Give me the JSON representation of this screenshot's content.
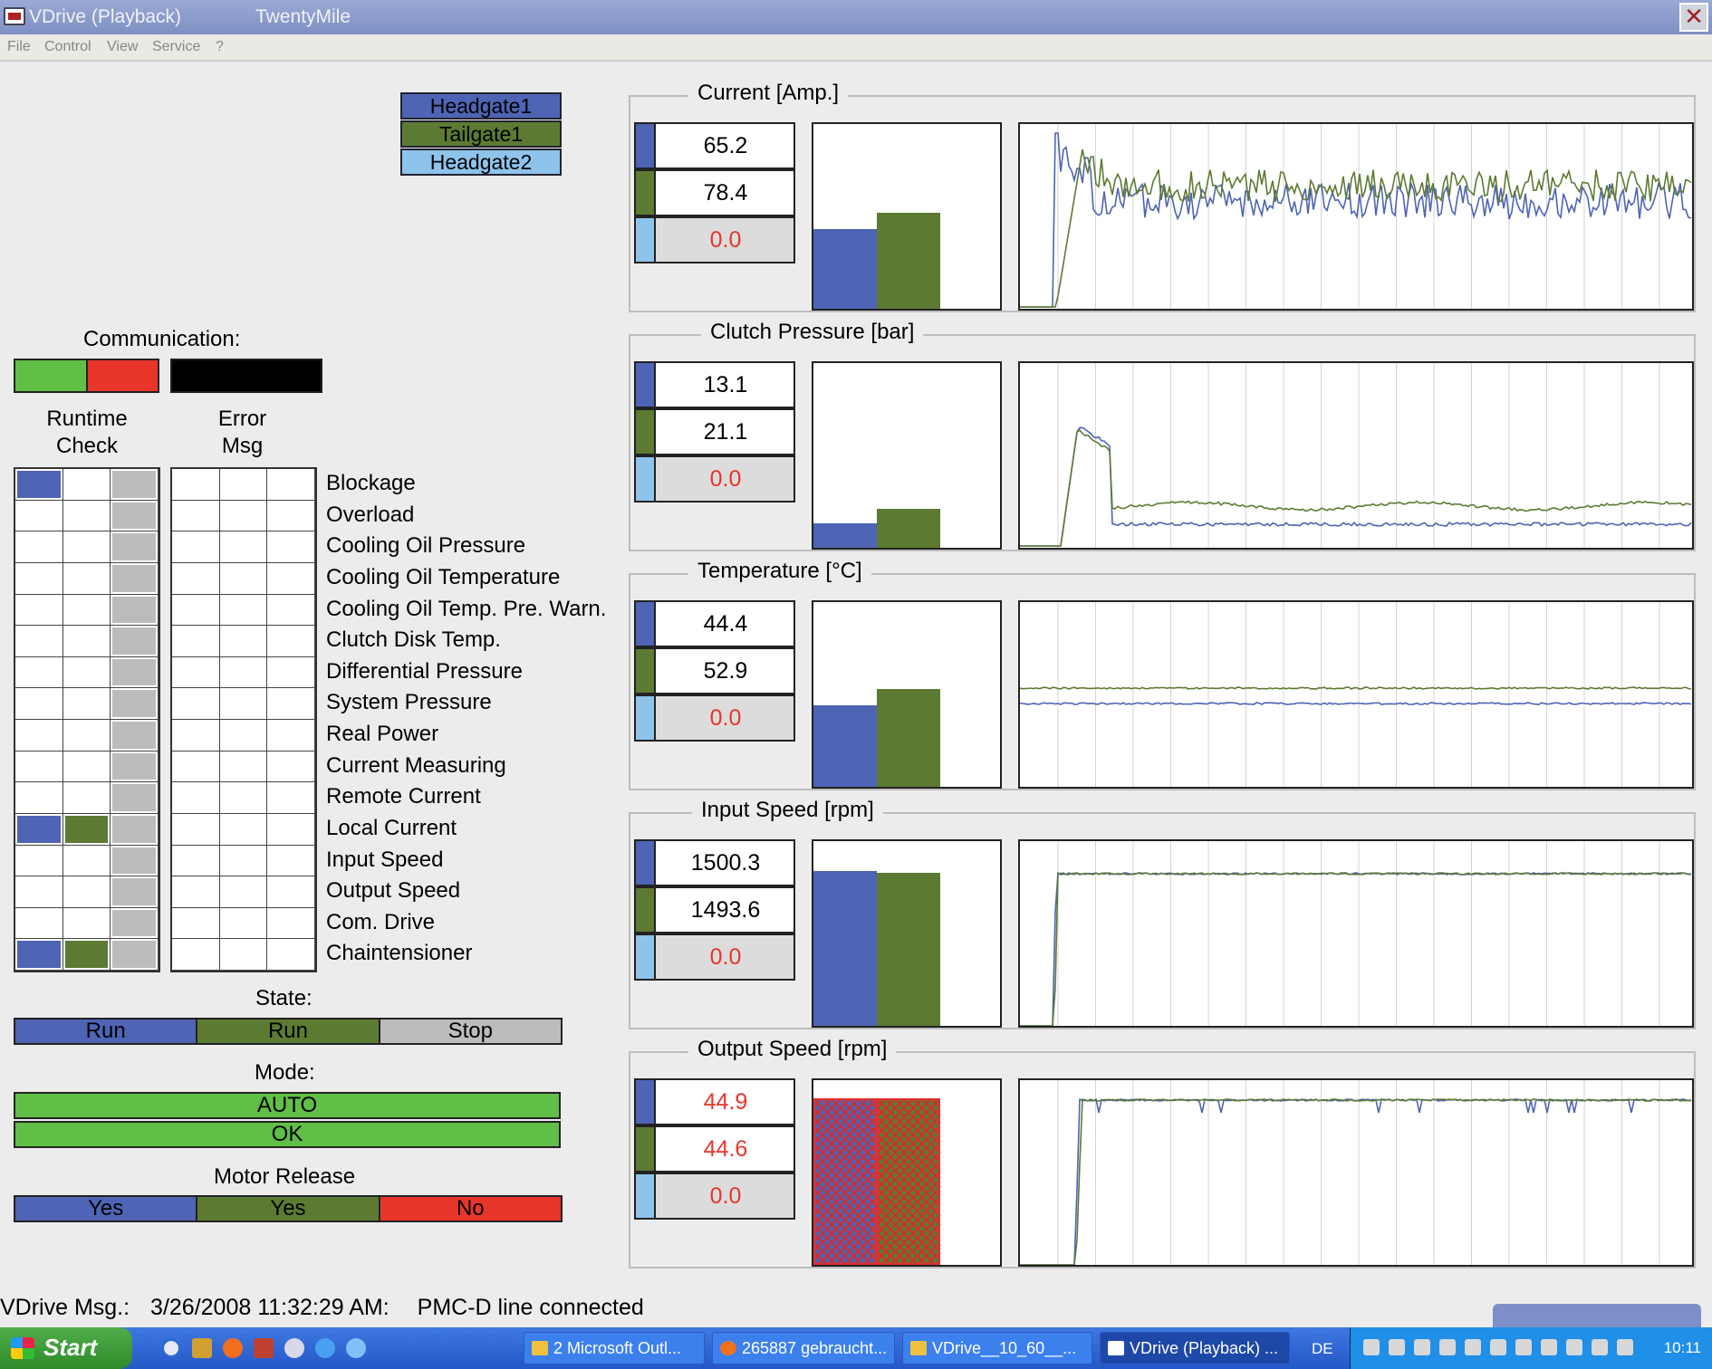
{
  "window": {
    "title": "VDrive (Playback)",
    "subtitle": "TwentyMile",
    "close_label": "✕"
  },
  "menu": [
    "File",
    "Control",
    "View",
    "Service",
    "?"
  ],
  "legend": [
    {
      "label": "Headgate1",
      "color": "#4e64b4"
    },
    {
      "label": "Tailgate1",
      "color": "#5d7a32"
    },
    {
      "label": "Headgate2",
      "color": "#8ec3ec"
    }
  ],
  "colors": {
    "headgate1": "#4e64b4",
    "tailgate1": "#5d7a32",
    "headgate2": "#8ec3ec",
    "green": "#5fbf46",
    "red": "#e8352a",
    "grey": "#bcbcbc",
    "alarm_text": "#e8352a"
  },
  "communication": {
    "label": "Communication:"
  },
  "runtime_header": "Runtime\nCheck",
  "error_header": "Error\nMsg",
  "checks": [
    {
      "label": "Blockage",
      "runtime": [
        "blue",
        "white",
        "grey"
      ]
    },
    {
      "label": "Overload",
      "runtime": [
        "white",
        "white",
        "grey"
      ]
    },
    {
      "label": "Cooling Oil Pressure",
      "runtime": [
        "white",
        "white",
        "grey"
      ]
    },
    {
      "label": "Cooling Oil Temperature",
      "runtime": [
        "white",
        "white",
        "grey"
      ]
    },
    {
      "label": "Cooling Oil Temp. Pre. Warn.",
      "runtime": [
        "white",
        "white",
        "grey"
      ]
    },
    {
      "label": "Clutch Disk Temp.",
      "runtime": [
        "white",
        "white",
        "grey"
      ]
    },
    {
      "label": "Differential Pressure",
      "runtime": [
        "white",
        "white",
        "grey"
      ]
    },
    {
      "label": "System Pressure",
      "runtime": [
        "white",
        "white",
        "grey"
      ]
    },
    {
      "label": "Real Power",
      "runtime": [
        "white",
        "white",
        "grey"
      ]
    },
    {
      "label": "Current Measuring",
      "runtime": [
        "white",
        "white",
        "grey"
      ]
    },
    {
      "label": "Remote Current",
      "runtime": [
        "white",
        "white",
        "grey"
      ]
    },
    {
      "label": "Local Current",
      "runtime": [
        "blue",
        "green",
        "grey"
      ]
    },
    {
      "label": "Input Speed",
      "runtime": [
        "white",
        "white",
        "grey"
      ]
    },
    {
      "label": "Output Speed",
      "runtime": [
        "white",
        "white",
        "grey"
      ]
    },
    {
      "label": "Com. Drive",
      "runtime": [
        "white",
        "white",
        "grey"
      ]
    },
    {
      "label": "Chaintensioner",
      "runtime": [
        "blue",
        "green",
        "grey"
      ]
    }
  ],
  "state": {
    "label": "State:",
    "values": [
      "Run",
      "Run",
      "Stop"
    ]
  },
  "mode": {
    "label": "Mode:",
    "values": [
      "AUTO",
      "OK"
    ]
  },
  "motor_release": {
    "label": "Motor Release",
    "values": [
      "Yes",
      "Yes",
      "No"
    ]
  },
  "panels": [
    {
      "title": "Current [Amp.]",
      "values": [
        "65.2",
        "78.4",
        "0.0"
      ],
      "alarm": [
        false,
        false,
        true
      ],
      "bar_fraction": [
        0.43,
        0.52
      ],
      "hatched": false,
      "trace": "current"
    },
    {
      "title": "Clutch Pressure [bar]",
      "values": [
        "13.1",
        "21.1",
        "0.0"
      ],
      "alarm": [
        false,
        false,
        true
      ],
      "bar_fraction": [
        0.13,
        0.21
      ],
      "hatched": false,
      "trace": "pressure"
    },
    {
      "title": "Temperature [°C]",
      "values": [
        "44.4",
        "52.9",
        "0.0"
      ],
      "alarm": [
        false,
        false,
        true
      ],
      "bar_fraction": [
        0.44,
        0.53
      ],
      "hatched": false,
      "trace": "temperature"
    },
    {
      "title": "Input Speed [rpm]",
      "values": [
        "1500.3",
        "1493.6",
        "0.0"
      ],
      "alarm": [
        false,
        false,
        true
      ],
      "bar_fraction": [
        0.84,
        0.83
      ],
      "hatched": false,
      "trace": "input"
    },
    {
      "title": "Output Speed [rpm]",
      "values": [
        "44.9",
        "44.6",
        "0.0"
      ],
      "alarm": [
        true,
        true,
        true
      ],
      "bar_fraction": [
        0.9,
        0.9
      ],
      "hatched": true,
      "trace": "output"
    }
  ],
  "status": {
    "label": "VDrive Msg.:",
    "time": "3/26/2008 11:32:29 AM:",
    "message": "PMC-D line connected"
  },
  "taskbar": {
    "start": "Start",
    "tasks": [
      "2 Microsoft Outl...",
      "265887 gebraucht...",
      "VDrive__10_60__...",
      "VDrive (Playback) ..."
    ],
    "lang": "DE",
    "clock": "10:11"
  }
}
